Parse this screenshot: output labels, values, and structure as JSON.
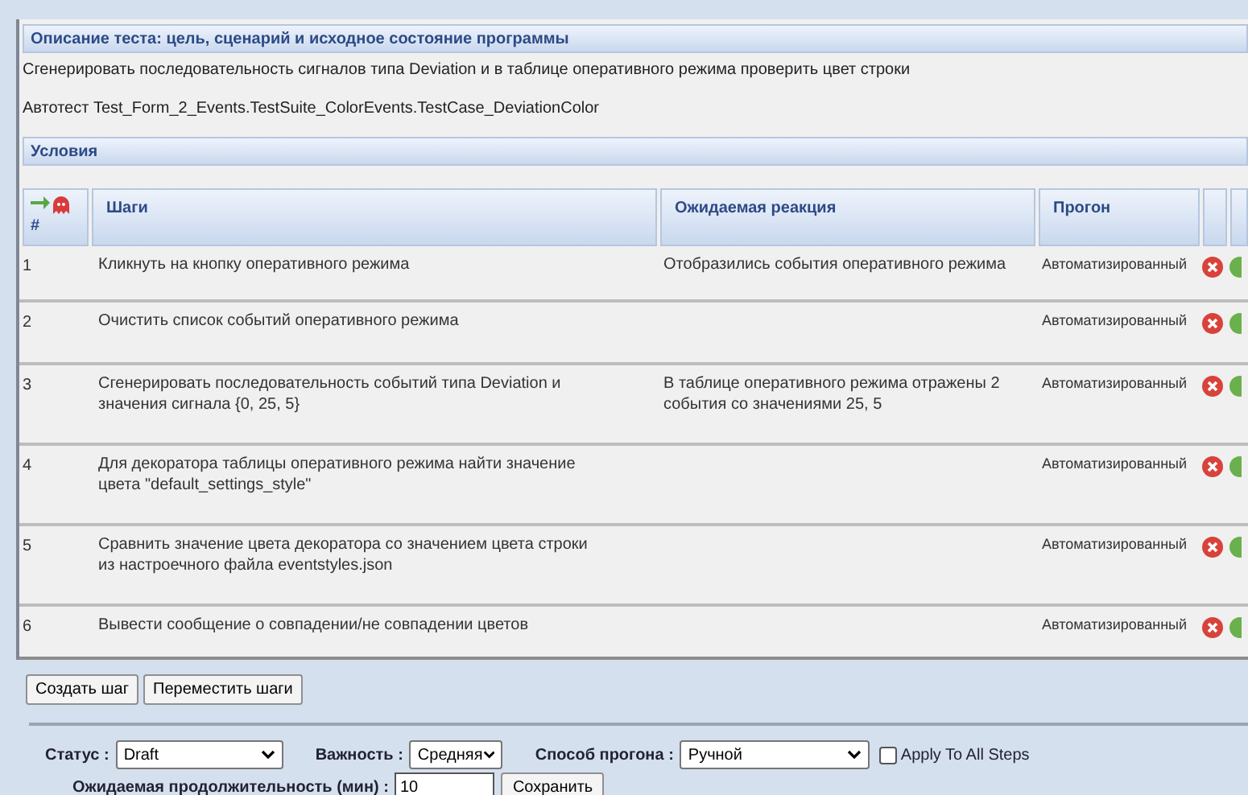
{
  "description": {
    "title": "Описание теста: цель, сценарий и исходное состояние программы",
    "text": "Сгенерировать последовательность сигналов типа Deviation и в таблице оперативного режима проверить цвет строки",
    "autotest": "Автотест Test_Form_2_Events.TestSuite_ColorEvents.TestCase_DeviationColor"
  },
  "conditions": {
    "title": "Условия"
  },
  "table": {
    "columns": [
      "#",
      "Шаги",
      "Ожидаемая реакция",
      "Прогон"
    ],
    "rows": [
      {
        "number": "1",
        "step": "Кликнуть на кнопку оперативного режима",
        "expected": "Отобразились события оперативного режима",
        "run": "Автоматизированный"
      },
      {
        "number": "2",
        "step": "Очистить список событий оперативного режима",
        "expected": "",
        "run": "Автоматизированный"
      },
      {
        "number": "3",
        "step": "Сгенерировать последовательность событий типа Deviation и значения сигнала {0, 25, 5}",
        "expected": "В таблице оперативного режима отражены 2 события со значениями 25, 5",
        "run": "Автоматизированный"
      },
      {
        "number": "4",
        "step": "Для декоратора таблицы оперативного режима найти значение цвета \"default_settings_style\"",
        "expected": "",
        "run": "Автоматизированный"
      },
      {
        "number": "5",
        "step": "Сравнить значение цвета декоратора со значением цвета строки из настроечного файла eventstyles.json",
        "expected": "",
        "run": "Автоматизированный"
      },
      {
        "number": "6",
        "step": "Вывести сообщение о совпадении/не совпадении цветов",
        "expected": "",
        "run": "Автоматизированный"
      }
    ]
  },
  "buttons": [
    "Создать шаг",
    "Переместить шаги"
  ],
  "form": {
    "status_label": "Статус :",
    "status": "Draft",
    "importance_label": "Важность :",
    "importance": "Средняя",
    "method_label": "Способ прогона :",
    "method": "Ручной",
    "apply_all": {
      "label": "Apply To All Steps",
      "checked": false
    },
    "duration_label": "Ожидаемая продолжительность (мин) :",
    "duration": "10",
    "save": "Сохранить"
  }
}
